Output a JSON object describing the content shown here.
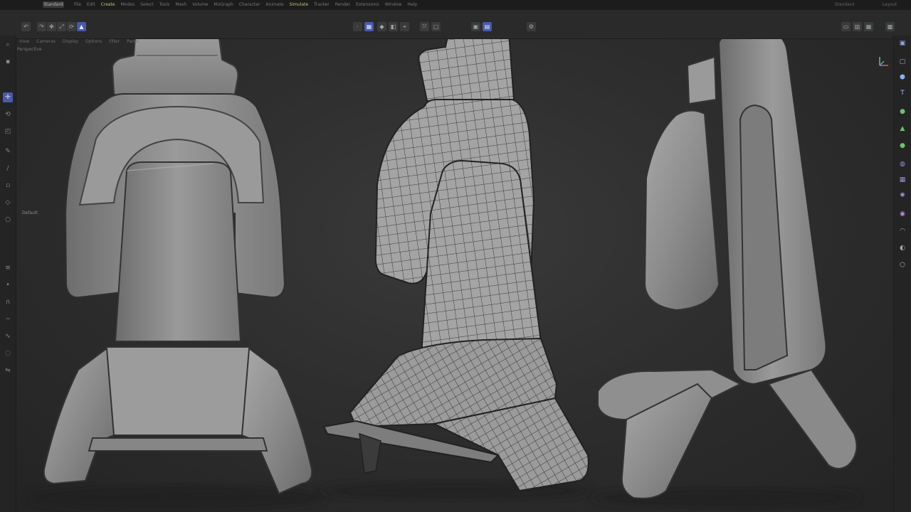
{
  "app": {
    "layout_label": "Standard",
    "menu": [
      "File",
      "Edit",
      "Create",
      "Modes",
      "Select",
      "Tools",
      "Mesh",
      "Volume",
      "MoGraph",
      "Character",
      "Animate",
      "Simulate",
      "Tracker",
      "Render",
      "Extensions",
      "Window",
      "Help"
    ],
    "menu_highlight": [
      "Create",
      "Simulate"
    ],
    "menu_right": [
      "Standard",
      "Layout"
    ]
  },
  "viewport": {
    "menu": [
      "View",
      "Cameras",
      "Display",
      "Options",
      "Filter",
      "Panel"
    ],
    "label": "Perspective",
    "hud": "Default"
  },
  "toolbar": {
    "left_icons": [
      "undo-icon",
      "redo-icon",
      "move-icon",
      "scale-icon",
      "rotate-icon",
      "select-icon"
    ],
    "center_icons": [
      "points-mode-icon",
      "edges-mode-icon",
      "polygons-mode-icon",
      "model-mode-icon",
      "snap-icon",
      "axis-icon",
      "workplane-icon",
      "render-view-icon",
      "render-icon",
      "render-settings-icon"
    ],
    "right_icons": [
      "layout-icon",
      "layout-b-icon",
      "layout-c-icon",
      "layout-d-icon"
    ]
  },
  "left_tools": [
    "move-tool-icon",
    "scale-tool-icon",
    "rotate-tool-icon",
    "select-tool-icon",
    "live-select-icon",
    "polygon-pen-icon",
    "knife-icon",
    "extrude-icon",
    "bevel-icon",
    "loop-icon",
    "bridge-icon",
    "weld-icon",
    "brush-icon",
    "magnet-icon",
    "smooth-icon",
    "spline-icon",
    "soft-selection-icon",
    "symmetry-icon"
  ],
  "right_tools": [
    "cube-icon",
    "sphere-icon",
    "cylinder-icon",
    "text-icon",
    "spline-pen-icon",
    "nurbs-icon",
    "cloner-icon",
    "deformer-icon",
    "camera-icon",
    "light-icon",
    "floor-icon",
    "sky-icon",
    "material-icon",
    "tag-icon"
  ],
  "colors": {
    "accent": "#4a5aa8",
    "menu_highlight": "#c9c46a",
    "model_fill": "#8e8e8e",
    "wire": "#2b2b2b"
  }
}
